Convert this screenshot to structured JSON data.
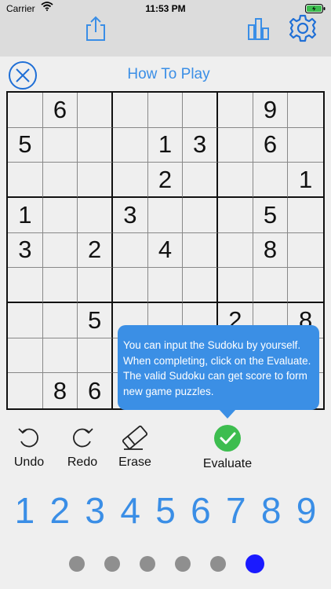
{
  "status": {
    "carrier": "Carrier",
    "time": "11:53 PM"
  },
  "toolbar": {
    "icons": [
      "share-icon",
      "bar-chart-icon",
      "gear-icon"
    ]
  },
  "header": {
    "title": "How To Play",
    "close_icon": "close-circle-icon"
  },
  "board": {
    "rows": [
      [
        "",
        "6",
        "",
        "",
        "",
        "",
        "",
        "9",
        ""
      ],
      [
        "5",
        "",
        "",
        "",
        "1",
        "3",
        "",
        "6",
        ""
      ],
      [
        "",
        "",
        "",
        "",
        "2",
        "",
        "",
        "",
        "1"
      ],
      [
        "1",
        "",
        "",
        "3",
        "",
        "",
        "",
        "5",
        ""
      ],
      [
        "3",
        "",
        "2",
        "",
        "4",
        "",
        "",
        "8",
        ""
      ],
      [
        "",
        "",
        "",
        "",
        "",
        "",
        "",
        "",
        ""
      ],
      [
        "",
        "",
        "5",
        "",
        "",
        "",
        "2",
        "",
        "8"
      ],
      [
        "",
        "",
        "",
        "",
        "",
        "",
        "",
        "",
        ""
      ],
      [
        "",
        "8",
        "6",
        "",
        "",
        "",
        "",
        "",
        ""
      ]
    ]
  },
  "tooltip": {
    "text": "You can input the Sudoku by yourself. When completing, click on the Evaluate. The valid Sudoku can get score to form new game puzzles."
  },
  "actions": {
    "undo": "Undo",
    "redo": "Redo",
    "erase": "Erase",
    "evaluate": "Evaluate"
  },
  "numpad": [
    "1",
    "2",
    "3",
    "4",
    "5",
    "6",
    "7",
    "8",
    "9"
  ],
  "pager": {
    "count": 6,
    "active_index": 5
  },
  "colors": {
    "accent": "#3a8ee6",
    "evaluate_green": "#3dbd4f",
    "active_dot": "#1a1aff"
  }
}
